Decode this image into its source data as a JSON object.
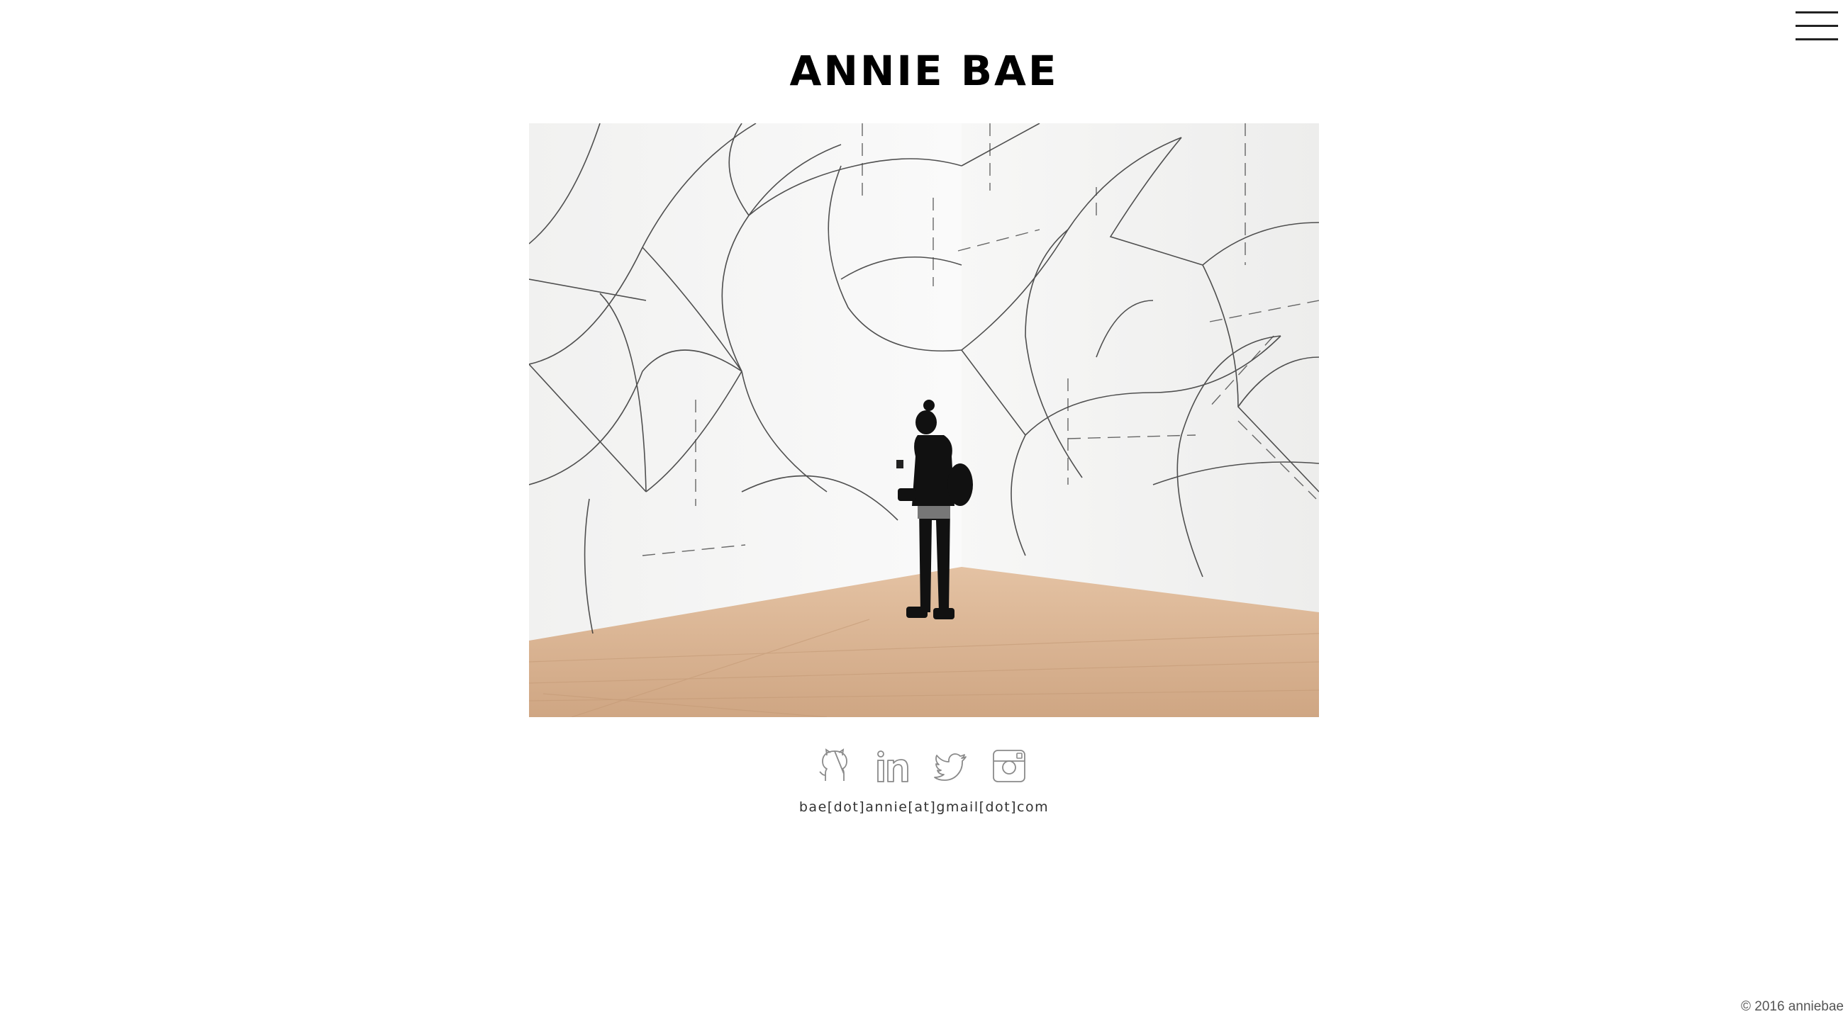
{
  "header": {
    "title": "ANNIE BAE",
    "menu_icon": "hamburger-menu-icon"
  },
  "hero": {
    "image_subject": "gallery-photo"
  },
  "social": [
    {
      "name": "github",
      "icon": "github-icon"
    },
    {
      "name": "linkedin",
      "icon": "linkedin-icon"
    },
    {
      "name": "twitter",
      "icon": "twitter-icon"
    },
    {
      "name": "instagram",
      "icon": "instagram-icon"
    }
  ],
  "contact": {
    "email": "bae[dot]annie[at]gmail[dot]com"
  },
  "footer": {
    "copyright": "© 2016 anniebae"
  },
  "colors": {
    "background": "#ffffff",
    "text": "#111111",
    "icon_stroke": "#8a8a8a",
    "floor": "#d9b391"
  }
}
